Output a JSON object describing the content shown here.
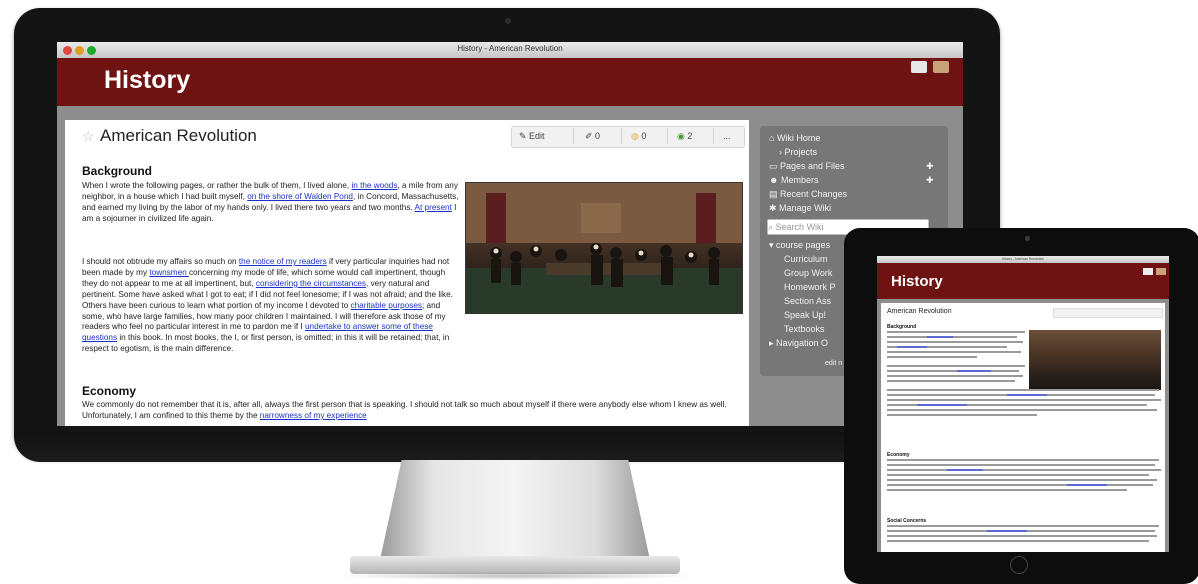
{
  "desktop": {
    "window_title": "History - American Revolution",
    "site_title": "History",
    "page_title": "American Revolution",
    "toolbar": {
      "edit_label": "Edit",
      "count_1": "0",
      "count_2": "0",
      "count_3": "2",
      "more_label": "..."
    },
    "sections": [
      {
        "heading": "Background",
        "p1_parts": [
          "When I wrote the following pages, or rather the bulk of them, I lived alone, ",
          "in the woods",
          ", a mile from any neighbor, in a house which I had built myself, ",
          "on the shore of Walden Pond",
          ", in Concord, Massachusetts, and earned my living by the labor of my hands only. I lived there two years and two months. ",
          "At present",
          " I am a sojourner in civilized life again."
        ],
        "p2_parts": [
          "I should not obtrude my affairs so much on ",
          "the notice of my readers",
          " if very particular inquiries had not been made by my ",
          "townsmen ",
          "concerning my mode of life, which some would call impertinent, though they do not appear to me at all impertinent, but, ",
          "considering the circumstances",
          ", very natural and pertinent. Some have asked what I got to eat; if I did not feel lonesome; if I was not afraid; and the like. Others have been curious to learn what portion of my income I devoted to ",
          "charitable purposes",
          "; and some, who have large families, how many poor children I maintained. I will therefore ask those of my readers who feel no particular interest in me to pardon me if I ",
          "undertake to answer some of these questions",
          " in this book. In most books, the I, or first person, is omitted; in this it will be retained; that, in respect to egotism, is the main difference."
        ]
      },
      {
        "heading": "Economy",
        "p1_parts": [
          "We commonly do not remember that it is, after all, always the first person that is speaking. I should not talk so much about myself if there were anybody else whom I knew as well. Unfortunately, I am confined to this theme by the ",
          "narrowness of my experience"
        ]
      }
    ],
    "sidebar": {
      "items": [
        "Wiki Home",
        "Projects",
        "Pages and Files",
        "Members",
        "Recent Changes",
        "Manage Wiki"
      ],
      "search_placeholder": "Search Wiki",
      "nav_items": [
        "course pages",
        "Curriculum",
        "Group Work",
        "Homework P",
        "Section Ass",
        "Speak Up!",
        "Textbooks",
        "Navigation O"
      ],
      "footer_text": "edit n"
    }
  },
  "tablet": {
    "window_title": "History - American Revolution",
    "site_title": "History",
    "page_title": "American Revolution",
    "headings": [
      "Background",
      "Economy",
      "Social Concerns"
    ]
  },
  "colors": {
    "header": "#6e1212",
    "link": "#1a32c8",
    "sidebar": "#777777"
  }
}
